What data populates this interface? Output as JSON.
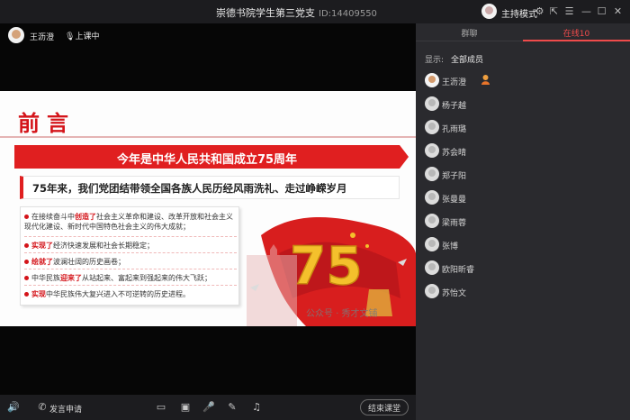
{
  "window": {
    "title": "崇德书院学生第三党支",
    "id_text": "ID:14409550",
    "mode_label": "主持模式",
    "icons": [
      "settings-icon",
      "share-icon",
      "menu-icon",
      "minimize-icon",
      "maximize-icon",
      "close-icon"
    ]
  },
  "video": {
    "host_name": "王沥澄",
    "status": "上课中"
  },
  "slide": {
    "title": "前言",
    "banner": "今年是中华人民共和国成立75周年",
    "subtitle": "75年来，我们党团结带领全国各族人民历经风雨洗礼、走过峥嵘岁月",
    "points": [
      {
        "pre": "在接续奋斗中",
        "hl": "创造了",
        "post": "社会主义革命和建设、改革开放和社会主义现代化建设、新时代中国特色社会主义的伟大成就；"
      },
      {
        "pre": "",
        "hl": "实现了",
        "post": "经济快速发展和社会长期稳定；"
      },
      {
        "pre": "",
        "hl": "绘就了",
        "post": "波澜壮阔的历史画卷；"
      },
      {
        "pre": "中华民族",
        "hl": "迎来了",
        "post": "从站起来、富起来到强起来的伟大飞跃；"
      },
      {
        "pre": "",
        "hl": "实现",
        "post": "中华民族伟大复兴进入不可逆转的历史进程。"
      }
    ],
    "big_number": "75",
    "watermark": "公众号 · 秀才文铺"
  },
  "bottombar": {
    "speaker_request": "发言申请",
    "end_button": "结束课堂"
  },
  "side": {
    "tab_chat": "群聊",
    "tab_online": "在线10",
    "filter_label": "显示:",
    "filter_value": "全部成员",
    "members": [
      "王沥澄",
      "杨子越",
      "孔雨璐",
      "苏会晴",
      "郑子阳",
      "张曼曼",
      "梁雨蓉",
      "张博",
      "欧阳昕睿",
      "苏怡文"
    ]
  },
  "colors": {
    "accent_red": "#e01f20",
    "tab_active": "#ef4b4b",
    "panel_bg": "#2a2a2e"
  }
}
